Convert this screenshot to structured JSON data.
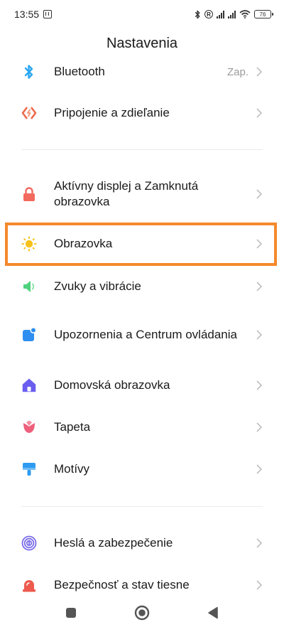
{
  "status_bar": {
    "time": "13:55",
    "battery": "76",
    "icons": [
      "nfc-icon",
      "bluetooth-icon",
      "roaming-icon",
      "signal-icon",
      "signal-icon",
      "wifi-icon",
      "battery-icon"
    ]
  },
  "header": {
    "title": "Nastavenia"
  },
  "settings": {
    "items": [
      {
        "label": "Bluetooth",
        "value": "Zap.",
        "icon": "bluetooth-icon",
        "color": "#2aa7f3"
      },
      {
        "label": "Pripojenie a zdieľanie",
        "icon": "connection-share-icon",
        "color": "#ee6a4a"
      },
      {
        "label": "Aktívny displej a Zamknutá obrazovka",
        "icon": "lock-icon",
        "color": "#f26a5e"
      },
      {
        "label": "Obrazovka",
        "icon": "sun-icon",
        "color": "#f7c21d"
      },
      {
        "label": "Zvuky a vibrácie",
        "icon": "speaker-icon",
        "color": "#4fd17e"
      },
      {
        "label": "Upozornenia a Centrum ovládania",
        "icon": "notification-icon",
        "color": "#2e8ff0"
      },
      {
        "label": "Domovská obrazovka",
        "icon": "home-icon",
        "color": "#6a5ef0"
      },
      {
        "label": "Tapeta",
        "icon": "tulip-icon",
        "color": "#ee5f7c"
      },
      {
        "label": "Motívy",
        "icon": "themes-icon",
        "color": "#2e9bf0"
      },
      {
        "label": "Heslá a zabezpečenie",
        "icon": "fingerprint-icon",
        "color": "#7a6ce8"
      },
      {
        "label": "Bezpečnosť a stav tiesne",
        "icon": "siren-icon",
        "color": "#ee5a4e"
      }
    ]
  },
  "colors": {
    "highlight": "#f5892b",
    "chevron": "#b8b8b8"
  },
  "nav_bar": {
    "icons": [
      "recents-square-icon",
      "home-circle-icon",
      "back-triangle-icon"
    ]
  }
}
